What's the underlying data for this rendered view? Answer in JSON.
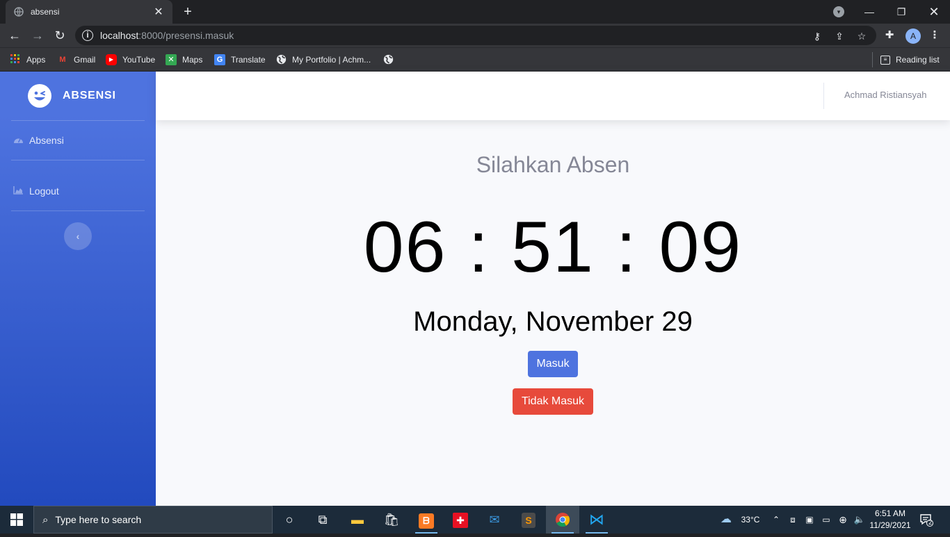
{
  "browser": {
    "tab_title": "absensi",
    "url_host": "localhost",
    "url_path": ":8000/presensi.masuk",
    "bookmarks": [
      "Apps",
      "Gmail",
      "YouTube",
      "Maps",
      "Translate",
      "My Portfolio | Achm..."
    ],
    "reading_list": "Reading list",
    "profile_initial": "A"
  },
  "sidebar": {
    "brand": "ABSENSI",
    "items": [
      {
        "label": "Absensi",
        "icon": "tachometer-icon"
      },
      {
        "label": "Logout",
        "icon": "chart-area-icon"
      }
    ]
  },
  "topbar": {
    "user_name": "Achmad Ristiansyah"
  },
  "main": {
    "heading": "Silahkan Absen",
    "clock": "06 : 51 : 09",
    "date": "Monday, November 29",
    "btn_in": "Masuk",
    "btn_out": "Tidak Masuk"
  },
  "taskbar": {
    "search_placeholder": "Type here to search",
    "weather": "33°C",
    "time": "6:51 AM",
    "date": "11/29/2021",
    "notifications": "2"
  },
  "colors": {
    "primary": "#4e73df",
    "danger": "#e74a3b",
    "sidebar_gradient_end": "#224abe"
  }
}
